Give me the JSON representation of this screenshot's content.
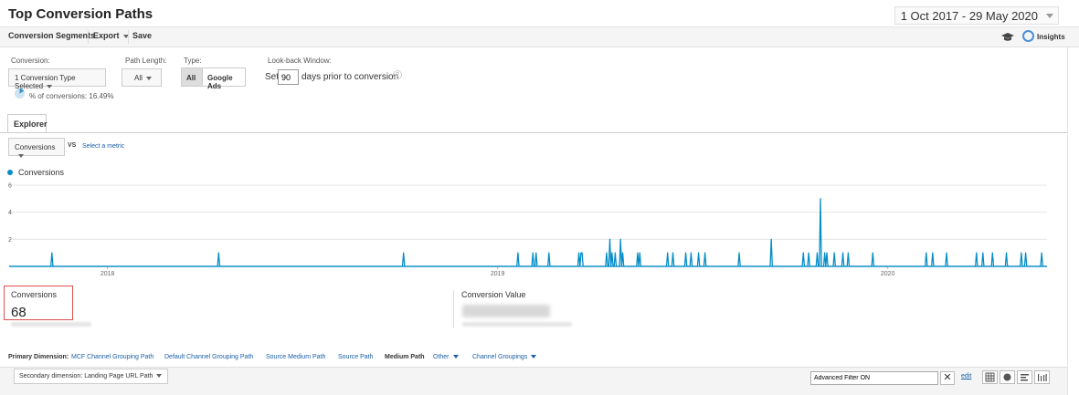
{
  "header": {
    "title": "Top Conversion Paths",
    "date_range": "1 Oct 2017 - 29 May 2020"
  },
  "toolbar": {
    "conversion_segments": "Conversion Segments",
    "export": "Export",
    "save": "Save",
    "insights": "Insights"
  },
  "filters": {
    "conversion_label": "Conversion:",
    "conversion_value": "1 Conversion Type Selected",
    "percent_of_conversions": "% of conversions: 16.49%",
    "percent_value": 16.49,
    "path_length_label": "Path Length:",
    "path_length_value": "All",
    "type_label": "Type:",
    "type_all": "All",
    "type_google_ads": "Google Ads",
    "lookback_label": "Look-back Window:",
    "lookback_set": "Set",
    "lookback_days": "90",
    "lookback_suffix": "days prior to conversion",
    "help": "?"
  },
  "explorer": {
    "tab_label": "Explorer",
    "metric_value": "Conversions",
    "vs": "VS",
    "select_metric": "Select a metric"
  },
  "chart_data": {
    "type": "line",
    "series": [
      {
        "name": "Conversions",
        "color": "#058dc7",
        "points": [
          [
            "2017-11-10",
            1
          ],
          [
            "2018-04-15",
            1
          ],
          [
            "2018-10-05",
            1
          ],
          [
            "2019-01-20",
            1
          ],
          [
            "2019-02-03",
            1
          ],
          [
            "2019-02-06",
            1
          ],
          [
            "2019-02-18",
            1
          ],
          [
            "2019-03-18",
            1
          ],
          [
            "2019-03-20",
            1
          ],
          [
            "2019-03-21",
            1
          ],
          [
            "2019-04-13",
            1
          ],
          [
            "2019-04-16",
            2
          ],
          [
            "2019-04-18",
            1
          ],
          [
            "2019-04-21",
            1
          ],
          [
            "2019-04-26",
            2
          ],
          [
            "2019-04-28",
            1
          ],
          [
            "2019-05-12",
            1
          ],
          [
            "2019-05-14",
            1
          ],
          [
            "2019-06-09",
            1
          ],
          [
            "2019-06-14",
            1
          ],
          [
            "2019-06-26",
            1
          ],
          [
            "2019-07-01",
            1
          ],
          [
            "2019-07-08",
            1
          ],
          [
            "2019-07-14",
            1
          ],
          [
            "2019-08-15",
            1
          ],
          [
            "2019-09-14",
            2
          ],
          [
            "2019-10-14",
            1
          ],
          [
            "2019-10-19",
            1
          ],
          [
            "2019-10-27",
            1
          ],
          [
            "2019-11-20",
            1
          ],
          [
            "2019-12-18",
            1
          ],
          [
            "2020-02-06",
            1
          ],
          [
            "2020-02-12",
            1
          ],
          [
            "2020-02-25",
            1
          ],
          [
            "2020-03-24",
            1
          ],
          [
            "2020-03-30",
            1
          ],
          [
            "2020-04-08",
            1
          ],
          [
            "2020-04-21",
            1
          ],
          [
            "2020-05-05",
            1
          ],
          [
            "2020-05-09",
            1
          ],
          [
            "2020-05-24",
            1
          ]
        ]
      }
    ],
    "extra_points": [
      [
        "2019-10-30",
        5
      ],
      [
        "2019-11-03",
        1
      ],
      [
        "2019-11-05",
        1
      ],
      [
        "2019-11-12",
        1
      ],
      [
        "2019-11-25",
        1
      ]
    ],
    "xlabel": "",
    "ylabel": "",
    "xlim": [
      "2017-10-01",
      "2020-05-29"
    ],
    "ylim": [
      0,
      6
    ],
    "y_ticks": [
      2,
      4,
      6
    ],
    "x_ticks": [
      "2018",
      "2019",
      "2020"
    ],
    "grid": true
  },
  "summary": {
    "conversions_label": "Conversions",
    "conversions_value": "68",
    "conversion_value_label": "Conversion Value"
  },
  "primary_dimension": {
    "label": "Primary Dimension:",
    "options": [
      "MCF Channel Grouping Path",
      "Default Channel Grouping Path",
      "Source Medium Path",
      "Source Path",
      "Medium Path",
      "Other",
      "Channel Groupings"
    ],
    "selected": "Medium Path"
  },
  "table_controls": {
    "secondary_dimension": "Secondary dimension: Landing Page URL Path",
    "advanced_filter": "Advanced Filter ON",
    "clear": "✕",
    "edit": "edit"
  }
}
